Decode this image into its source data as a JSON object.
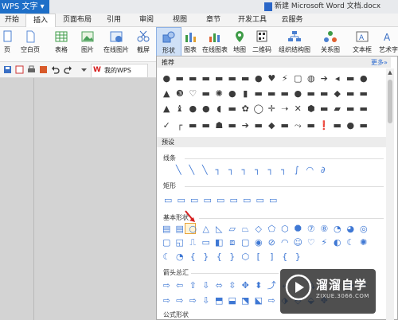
{
  "app": {
    "name": "WPS 文字",
    "dropdown": "▾"
  },
  "document": {
    "title": "新建 Microsoft Word 文档.docx"
  },
  "tabs": [
    {
      "label": "开始",
      "active": false
    },
    {
      "label": "插入",
      "active": true
    },
    {
      "label": "页面布局",
      "active": false
    },
    {
      "label": "引用",
      "active": false
    },
    {
      "label": "审阅",
      "active": false
    },
    {
      "label": "视图",
      "active": false
    },
    {
      "label": "章节",
      "active": false
    },
    {
      "label": "开发工具",
      "active": false
    },
    {
      "label": "云服务",
      "active": false
    }
  ],
  "ribbon": {
    "cover_page": "页",
    "blank_page": "空白页",
    "table": "表格",
    "picture": "图片",
    "online_picture": "在线图片",
    "screenshot": "截屏",
    "shapes": "形状",
    "chart": "图表",
    "online_chart": "在线图表",
    "map": "地图",
    "qrcode": "二维码",
    "org_chart": "组织结构图",
    "relation": "关系图",
    "textbox": "文本框",
    "art": "艺术字"
  },
  "quick_access": {
    "wps_tab": "我的WPS"
  },
  "gallery": {
    "recommended": "推荐",
    "more": "更多»",
    "preset": "预设",
    "lines": "线条",
    "rectangles": "矩形",
    "basic_shapes": "基本形状",
    "block_arrows": "箭头总汇",
    "formula_shapes": "公式形状",
    "rec_row1": "● ▬ ▬ ▬ ▬ ▬ ▬ ● ♥ ⚡ ▢ ◍ ➔ ◂ ▬ ●",
    "rec_row2": "▲ ❸ ♡ ▬ ✺ ● ▮ ▬ ▬ ▬ ● ▬ ▬ ◆ ▬ ▬",
    "rec_row3": "▲ ♝ ● ● ◖ ▬ ✿ ◯ ✛ ➝ ✕ ⬢ ▬ ▰ ▬ ▬",
    "rec_row4": "✓ ┌ ▬ ▬ ☗ ▬ ➔ ▬ ◆ ▬ ⤳ ▬ ❗ ▬ ● ▬",
    "lines_row": "╲ ╲ ╲ ┐ ┐ ┐ ┐ ┐ ┐ ∫ ◠ ∂",
    "rect_row": "▭ ▭ ▭ ▭ ▭ ▭ ▭ ▭ ▭",
    "basic_row1": "▤ ▤ ○ △ ◺ ▱ ⏢ ◇ ⬠ ⬡ ⯃ ⑦ ⑧ ◔ ◕ ◎",
    "basic_row2": "▢ ◱ ⎍ ▭ ◧ ⧈ ▢ ◉ ⊘ ◠ ☺ ♡ ⚡ ◐ ☾ ✺",
    "basic_row3": "☾ ◔ { } { } ⬡ [ ] { }",
    "arrows_row1": "⇨ ⇦ ⇧ ⇩ ⬄ ⇳ ✥ ⬍ ⤴ ⤶ ⤷ ⤵ ⬑ ⇱ ⬅ ⇨",
    "arrows_row2": "⇨ ⇨ ⇨ ⇩ ⬒ ⬓ ⬔ ⬕ ⇨ ⬗ ⬘ ⬙ ✥",
    "watermark_name": "溜溜自学",
    "watermark_url": "ZIXUE.3066.COM"
  },
  "colors": {
    "app_blue": "#1e6fc8",
    "accent_blue": "#3f78d4",
    "highlight": "#e8a33a",
    "arrow_red": "#d62020"
  }
}
